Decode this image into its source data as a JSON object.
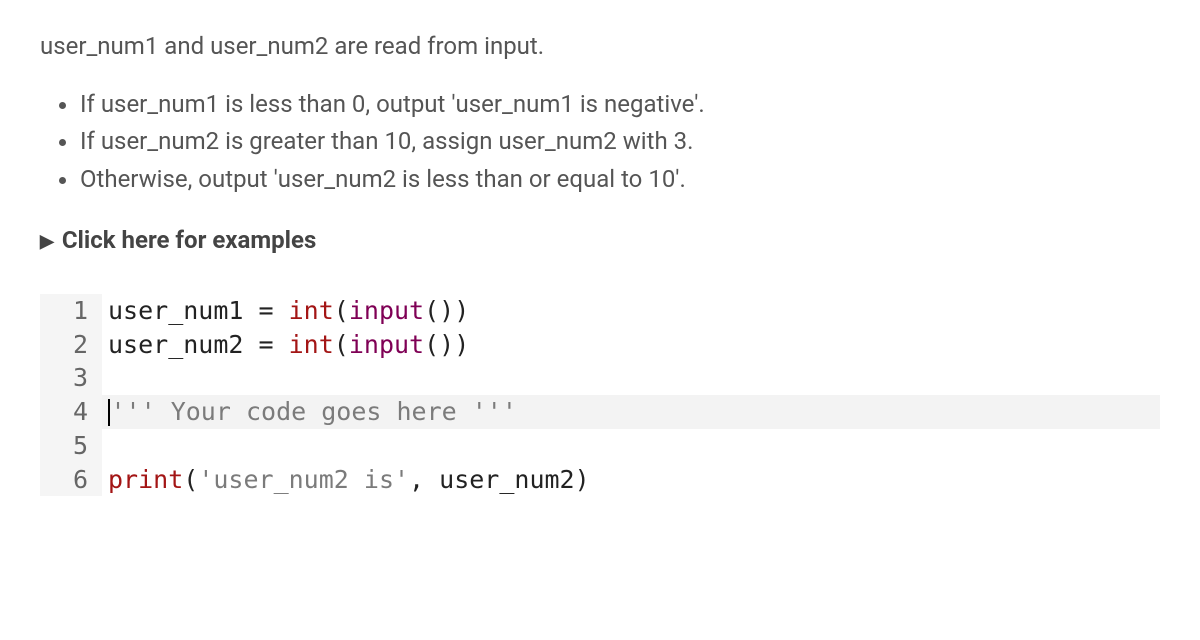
{
  "intro": "user_num1 and user_num2 are read from input.",
  "bullets": [
    "If user_num1 is less than 0, output 'user_num1 is negative'.",
    "If user_num2 is greater than 10, assign user_num2 with 3.",
    "Otherwise, output 'user_num2 is less than or equal to 10'."
  ],
  "examples_toggle": "Click here for examples",
  "code": {
    "line1_user_num1": "user_num1",
    "line1_eq": " = ",
    "line1_int": "int",
    "line1_open": "(",
    "line1_input": "input",
    "line1_close": "())",
    "line2_user_num2": "user_num2",
    "line2_eq": " = ",
    "line2_int": "int",
    "line2_open": "(",
    "line2_input": "input",
    "line2_close": "())",
    "line4_str": "''' Your code goes here '''",
    "line6_print": "print",
    "line6_open": "(",
    "line6_str": "'user_num2 is'",
    "line6_comma": ", user_num2)",
    "gutter": {
      "l1": "1",
      "l2": "2",
      "l3": "3",
      "l4": "4",
      "l5": "5",
      "l6": "6"
    }
  }
}
